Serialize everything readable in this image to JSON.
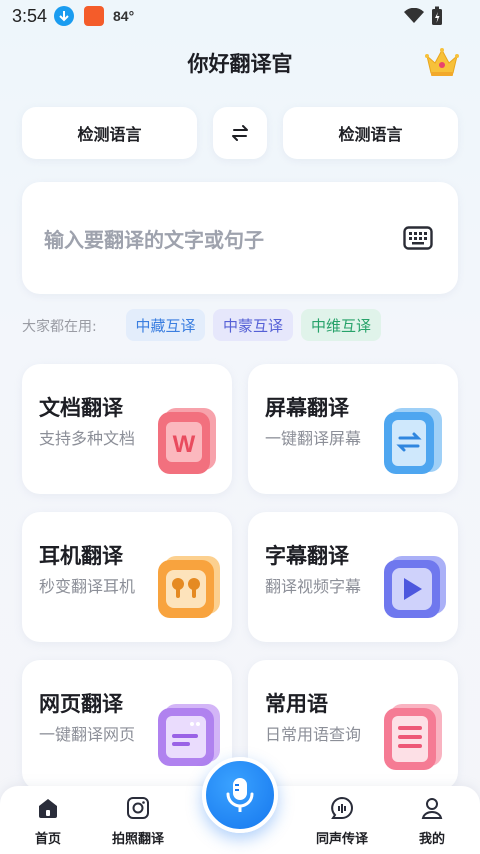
{
  "status_bar": {
    "time": "3:54",
    "temperature": "84°"
  },
  "header": {
    "title": "你好翻译官",
    "vip_icon": "crown-icon"
  },
  "language_bar": {
    "source_label": "检测语言",
    "target_label": "检测语言",
    "swap_icon": "swap-arrows-icon"
  },
  "input": {
    "placeholder": "输入要翻译的文字或句子",
    "keyboard_icon": "keyboard-icon"
  },
  "popular": {
    "label": "大家都在用:",
    "chips": [
      "中藏互译",
      "中蒙互译",
      "中维互译"
    ]
  },
  "tiles": [
    {
      "title": "文档翻译",
      "subtitle": "支持多种文档",
      "icon": "word-document-icon",
      "color": "#f2707e"
    },
    {
      "title": "屏幕翻译",
      "subtitle": "一键翻译屏幕",
      "icon": "phone-screen-icon",
      "color": "#4ea6f0"
    },
    {
      "title": "耳机翻译",
      "subtitle": "秒变翻译耳机",
      "icon": "earbuds-icon",
      "color": "#f8a33e"
    },
    {
      "title": "字幕翻译",
      "subtitle": "翻译视频字幕",
      "icon": "play-video-icon",
      "color": "#6f78ee"
    },
    {
      "title": "网页翻译",
      "subtitle": "一键翻译网页",
      "icon": "web-page-icon",
      "color": "#b082ef"
    },
    {
      "title": "常用语",
      "subtitle": "日常用语查询",
      "icon": "phrase-list-icon",
      "color": "#f57b94"
    }
  ],
  "bottom_nav": {
    "items": [
      {
        "label": "首页",
        "icon": "home-icon"
      },
      {
        "label": "拍照翻译",
        "icon": "camera-icon"
      },
      {
        "label": "同声传译",
        "icon": "voice-chat-icon"
      },
      {
        "label": "我的",
        "icon": "profile-icon"
      }
    ],
    "mic_icon": "microphone-icon"
  },
  "colors": {
    "accent": "#1677ee",
    "background": "#f3f6fb",
    "card": "#ffffff"
  }
}
